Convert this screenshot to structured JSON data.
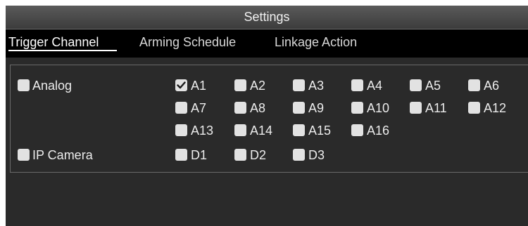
{
  "window": {
    "title": "Settings"
  },
  "tabs": [
    {
      "label": "Trigger Channel",
      "active": true
    },
    {
      "label": "Arming Schedule",
      "active": false
    },
    {
      "label": "Linkage Action",
      "active": false
    }
  ],
  "analog": {
    "label": "Analog",
    "checked": false,
    "channels": [
      {
        "label": "A1",
        "checked": true
      },
      {
        "label": "A2",
        "checked": false
      },
      {
        "label": "A3",
        "checked": false
      },
      {
        "label": "A4",
        "checked": false
      },
      {
        "label": "A5",
        "checked": false
      },
      {
        "label": "A6",
        "checked": false
      },
      {
        "label": "A7",
        "checked": false
      },
      {
        "label": "A8",
        "checked": false
      },
      {
        "label": "A9",
        "checked": false
      },
      {
        "label": "A10",
        "checked": false
      },
      {
        "label": "A11",
        "checked": false
      },
      {
        "label": "A12",
        "checked": false
      },
      {
        "label": "A13",
        "checked": false
      },
      {
        "label": "A14",
        "checked": false
      },
      {
        "label": "A15",
        "checked": false
      },
      {
        "label": "A16",
        "checked": false
      }
    ]
  },
  "ip_camera": {
    "label": "IP Camera",
    "checked": false,
    "channels": [
      {
        "label": "D1",
        "checked": false
      },
      {
        "label": "D2",
        "checked": false
      },
      {
        "label": "D3",
        "checked": false
      }
    ]
  },
  "colors": {
    "background": "#2a2a2a",
    "tab_bar": "#000000",
    "checkbox": "#e2e2e2",
    "checkmark": "#1a1a1a"
  }
}
